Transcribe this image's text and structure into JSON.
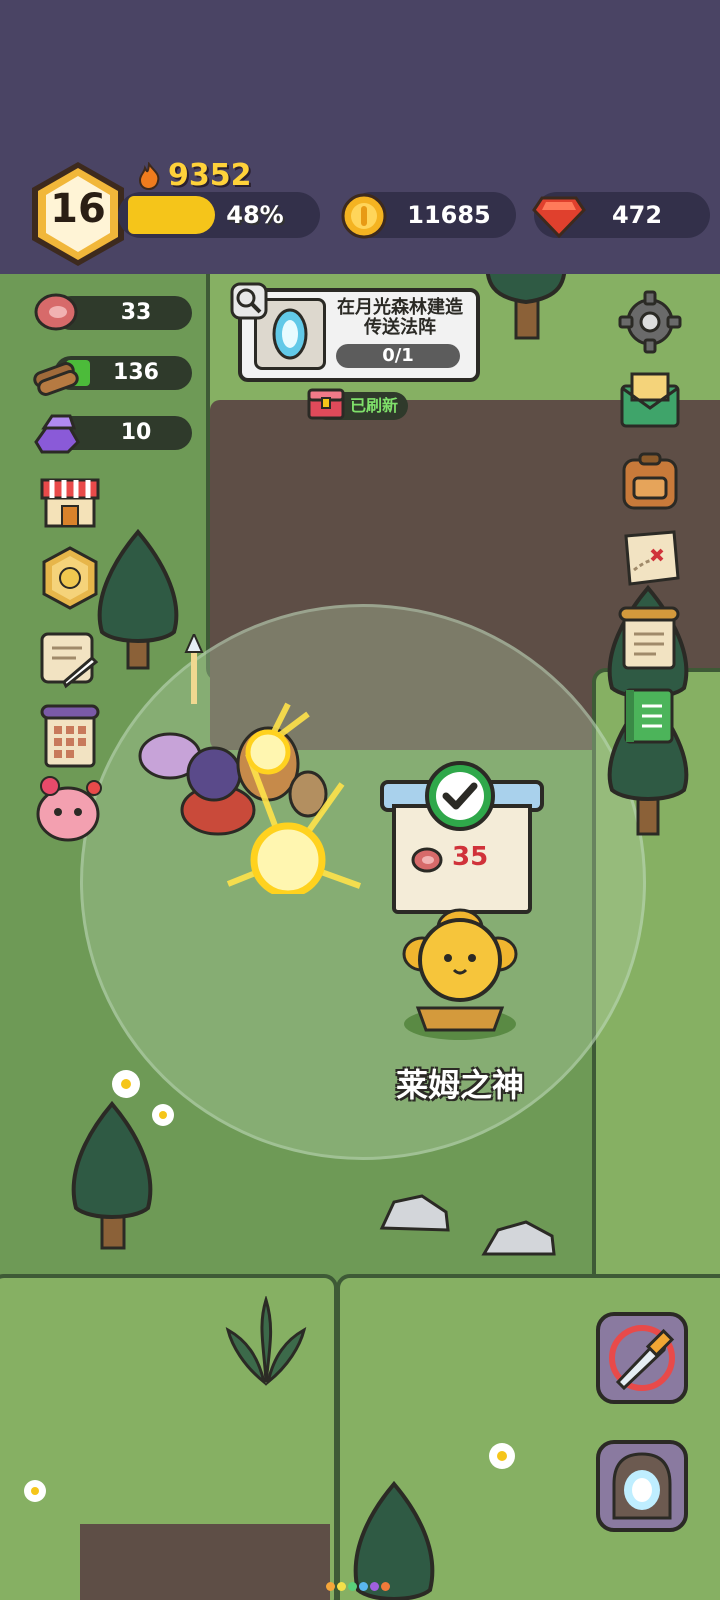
{
  "player": {
    "level": "16",
    "power": "9352",
    "xp_percent_label": "48%",
    "xp_percent": 0.48
  },
  "currencies": {
    "coins": "11685",
    "gems": "472"
  },
  "resources": {
    "meat": "33",
    "wood": "136",
    "crystal": "10"
  },
  "quest": {
    "title": "在月光森林建造传送法阵",
    "progress": "0/1"
  },
  "chest_badge": {
    "label": "已刷新"
  },
  "building": {
    "cost": "35",
    "name": "莱姆之神"
  },
  "colors": {
    "top_bar": "#4a4464",
    "grass": "#6e9a56",
    "xp_fill": "#f5c51a",
    "level_badge": "#f1b73a"
  },
  "icons": {
    "left": [
      "shop-icon",
      "achievement-medal-icon",
      "scroll-feather-icon",
      "calendar-scroll-icon",
      "pink-pet-icon"
    ],
    "right": [
      "settings-gear-icon",
      "mail-icon",
      "backpack-icon",
      "treasure-map-icon",
      "quest-board-icon",
      "guide-book-icon"
    ],
    "bottom_right": [
      "battle-swords-icon",
      "portal-icon"
    ]
  }
}
